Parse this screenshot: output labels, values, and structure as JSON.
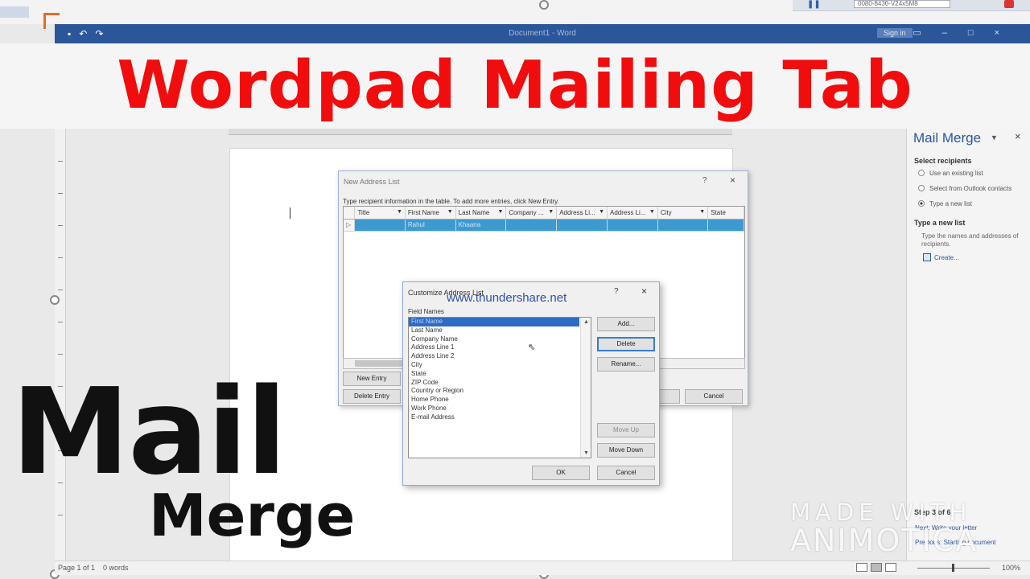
{
  "banner": {
    "title": "Wordpad Mailing Tab"
  },
  "word": {
    "doc_title": "Document1 - Word",
    "sign_in": "Sign in"
  },
  "tray": {
    "field_text": "0080-8430-V24x5M8"
  },
  "status": {
    "page": "Page 1 of 1",
    "words": "0 words",
    "zoom": "100%"
  },
  "mail_merge": {
    "title": "Mail Merge",
    "select_recipients": "Select recipients",
    "options": [
      "Use an existing list",
      "Select from Outlook contacts",
      "Type a new list"
    ],
    "type_new_heading": "Type a new list",
    "type_new_desc": "Type the names and addresses of recipients.",
    "create_link": "Create...",
    "step": "Step 3 of 6",
    "next_link": "Next: Write your letter",
    "prev_link": "Previous: Starting document"
  },
  "new_address_list": {
    "title": "New Address List",
    "instructions": "Type recipient information in the table.  To add more entries, click New Entry.",
    "columns": [
      "Title",
      "First Name",
      "Last Name",
      "Company ...",
      "Address Li...",
      "Address Li...",
      "City",
      "State"
    ],
    "row": [
      "",
      "Rahul",
      "Khaana",
      "",
      "",
      "",
      "",
      ""
    ],
    "new_entry": "New Entry",
    "delete_entry": "Delete Entry",
    "cancel": "Cancel"
  },
  "customize": {
    "title": "Customize Address List",
    "watermark_url": "www.thundershare.net",
    "field_names_label": "Field Names",
    "fields": [
      "First Name",
      "Last Name",
      "Company Name",
      "Address Line 1",
      "Address Line 2",
      "City",
      "State",
      "ZIP Code",
      "Country or Region",
      "Home Phone",
      "Work Phone",
      "E-mail Address"
    ],
    "add": "Add...",
    "delete": "Delete",
    "rename": "Rename...",
    "move_up": "Move Up",
    "move_down": "Move Down",
    "ok": "OK",
    "cancel": "Cancel"
  },
  "overlay": {
    "mail": "Mail",
    "merge": "Merge"
  },
  "watermark": {
    "line1": "MADE WITH",
    "line2": "ANIMOTICA"
  },
  "colors": {
    "banner_red": "#f10d0d",
    "word_blue": "#2b579a",
    "selection_blue": "#3d9ad1"
  }
}
